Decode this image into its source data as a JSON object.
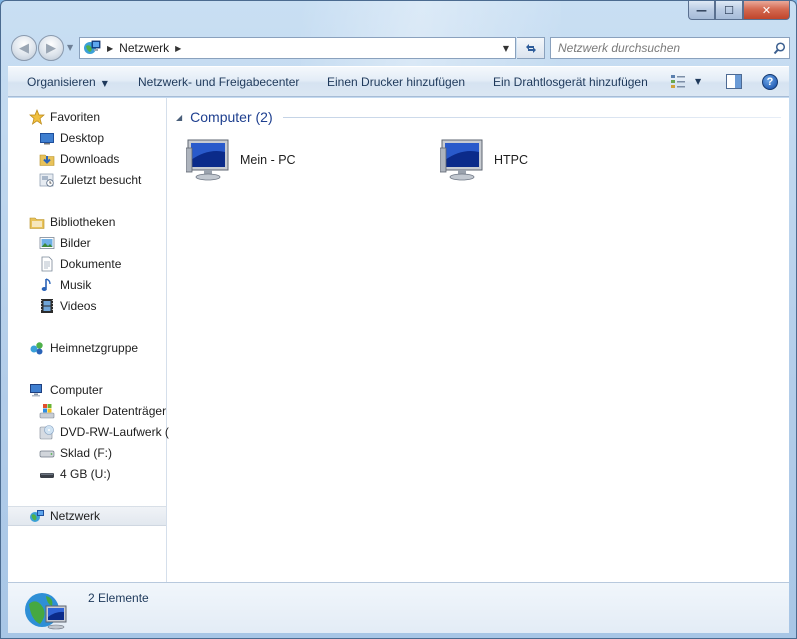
{
  "window": {
    "caption_minimize": "—",
    "caption_maximize": "☐",
    "caption_close": "✕"
  },
  "address": {
    "crumb": "Netzwerk",
    "search_placeholder": "Netzwerk durchsuchen"
  },
  "commands": {
    "organize": "Organisieren",
    "network_center": "Netzwerk- und Freigabecenter",
    "add_printer": "Einen Drucker hinzufügen",
    "add_wireless": "Ein Drahtlosgerät hinzufügen",
    "help": "?"
  },
  "sidebar": {
    "favorites": "Favoriten",
    "desktop": "Desktop",
    "downloads": "Downloads",
    "recent": "Zuletzt besucht",
    "libraries": "Bibliotheken",
    "pictures": "Bilder",
    "documents": "Dokumente",
    "music": "Musik",
    "videos": "Videos",
    "homegroup": "Heimnetzgruppe",
    "computer": "Computer",
    "local_disk": "Lokaler Datenträger",
    "dvd": "DVD-RW-Laufwerk (",
    "sklad": "Sklad (F:)",
    "usb": "4 GB (U:)",
    "network": "Netzwerk"
  },
  "main": {
    "group_title": "Computer (2)",
    "computers": [
      "Mein - PC",
      "HTPC"
    ]
  },
  "status": {
    "count": "2 Elemente"
  }
}
